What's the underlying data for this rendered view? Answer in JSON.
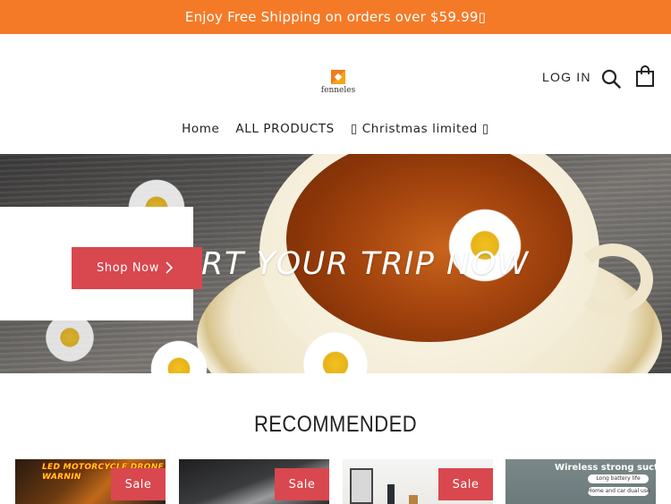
{
  "announcement": {
    "text": "Enjoy Free Shipping on orders over $59.99▯"
  },
  "header": {
    "logo_text": "fenneles",
    "login_label": "LOG IN",
    "icons": {
      "search": "search-icon",
      "cart": "shopping-bag-icon"
    }
  },
  "nav": {
    "items": [
      {
        "label": "Home"
      },
      {
        "label": "ALL PRODUCTS"
      },
      {
        "label": "▯ Christmas limited ▯"
      }
    ]
  },
  "hero": {
    "title": "RT YOUR TRIP NOW",
    "button_label": "Shop Now"
  },
  "recommended": {
    "title": "RECOMMENDED",
    "products": [
      {
        "badge": "Sale",
        "image_text": [
          "LED MOTORCYCLE DRONE",
          "WARNIN"
        ]
      },
      {
        "badge": "Sale"
      },
      {
        "badge": "Sale"
      },
      {
        "image_text": [
          "Wireless strong suction",
          "Long battery life",
          "Home and car dual use"
        ]
      }
    ]
  },
  "colors": {
    "announcement_bg": "#f57a27",
    "accent": "#d9474f",
    "logo_orange": "#f7a21b"
  }
}
